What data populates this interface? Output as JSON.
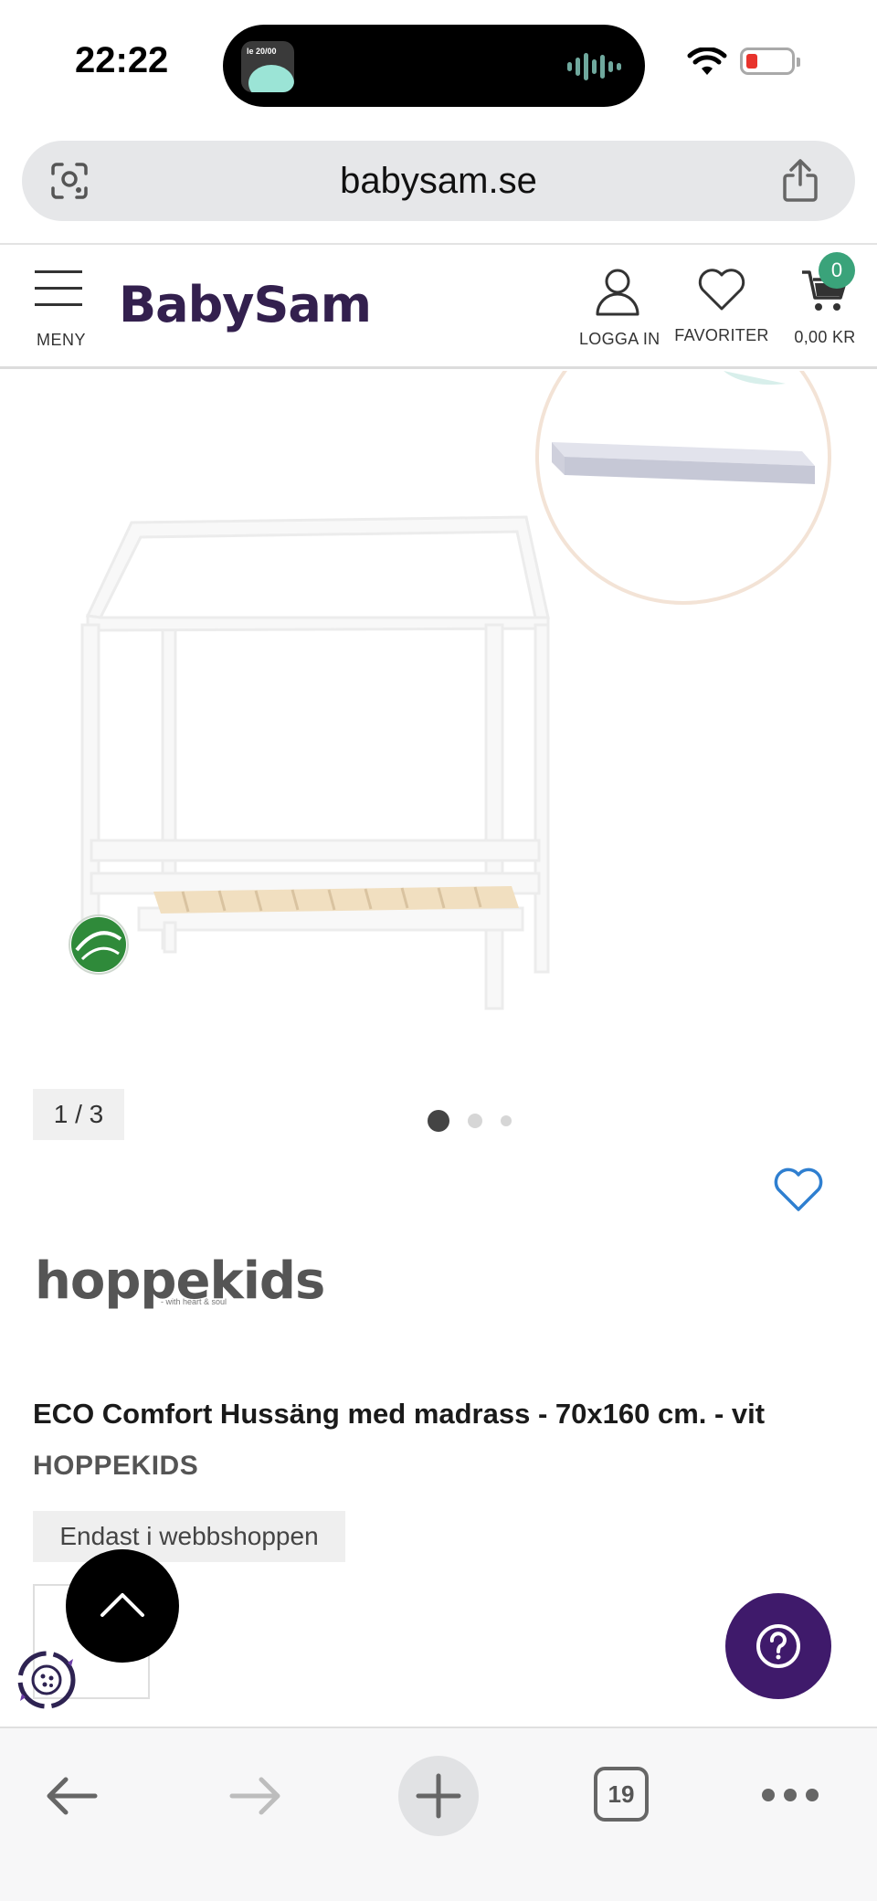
{
  "status_bar": {
    "time": "22:22",
    "island_thumb_text": "le 20/00"
  },
  "browser": {
    "url": "babysam.se",
    "tab_count": "19"
  },
  "header": {
    "logo": "BabySam",
    "menu_label": "MENY",
    "login_label": "LOGGA IN",
    "favorites_label": "FAVORITER",
    "cart_amount": "0,00 KR",
    "cart_count": "0",
    "brand_color": "#33204e",
    "badge_color": "#3aa37a"
  },
  "gallery": {
    "counter": "1 / 3",
    "total_images": 3,
    "active_index": 0
  },
  "product": {
    "brand_logo": "hoppekids",
    "brand_logo_sub": "- with heart & soul",
    "title": "ECO Comfort Hussäng med madrass - 70x160 cm. - vit",
    "brand": "HOPPEKIDS",
    "badge": "Endast i webbshoppen"
  },
  "icons": {
    "scroll_top": "chevron-up-icon",
    "help": "question-icon",
    "cookie": "cookie-icon"
  }
}
